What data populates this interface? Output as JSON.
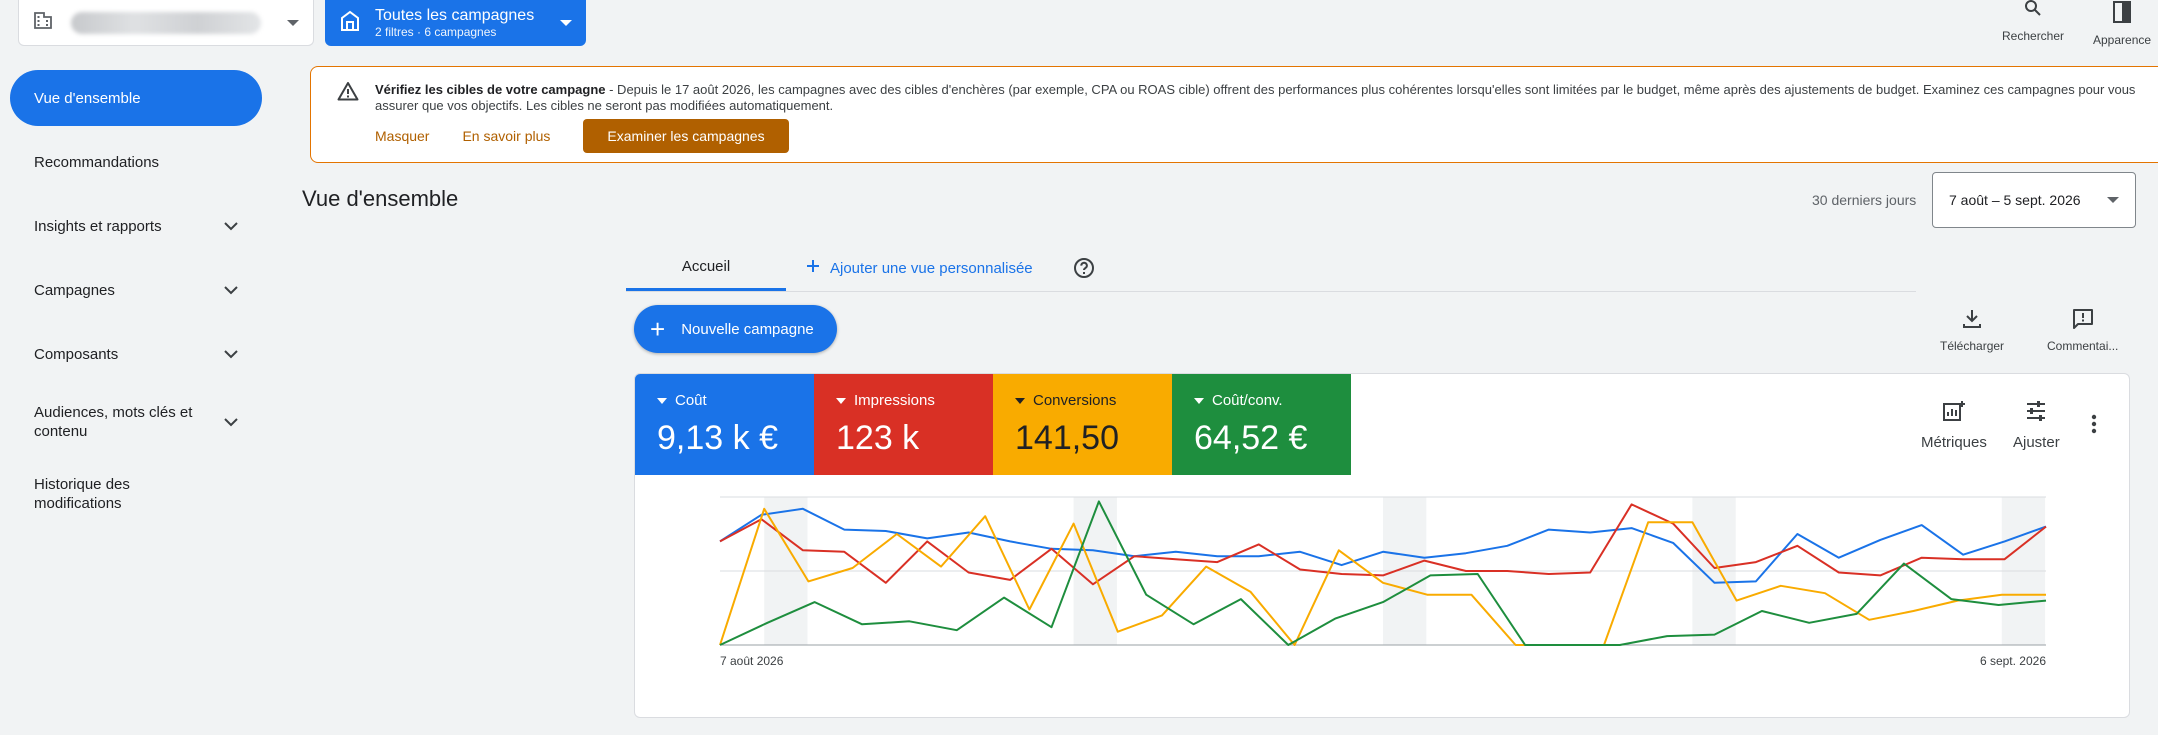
{
  "topbar": {
    "campaign_filter_title": "Toutes les campagnes",
    "campaign_filter_sub": "2 filtres · 6 campagnes",
    "search_label": "Rechercher",
    "appearance_label": "Apparence"
  },
  "sidebar": {
    "items": [
      {
        "label": "Vue d'ensemble"
      },
      {
        "label": "Recommandations"
      },
      {
        "label": "Insights et rapports"
      },
      {
        "label": "Campagnes"
      },
      {
        "label": "Composants"
      },
      {
        "label": "Audiences, mots clés et contenu"
      },
      {
        "label": "Historique des modifications"
      }
    ]
  },
  "banner": {
    "title": "Vérifiez les cibles de votre campagne",
    "text": " - Depuis le 17 août 2026, les campagnes avec des cibles d'enchères (par exemple, CPA ou ROAS cible) offrent des performances plus cohérentes lorsqu'elles sont limitées par le budget, même après des ajustements de budget. Examinez ces campagnes pour vous assurer que vos objectifs. Les cibles ne seront pas modifiées automatiquement.",
    "dismiss": "Masquer",
    "learn_more": "En savoir plus",
    "review": "Examiner les campagnes"
  },
  "header": {
    "title": "Vue d'ensemble",
    "range_label": "30 derniers jours",
    "date_range": "7 août – 5 sept. 2026"
  },
  "tabs": {
    "home": "Accueil",
    "add_view": "Ajouter une vue personnalisée"
  },
  "toolbar": {
    "new_campaign": "Nouvelle campagne",
    "download": "Télécharger",
    "comments": "Commentai..."
  },
  "metrics": [
    {
      "label": "Coût",
      "value": "9,13 k €",
      "color": "#1a73e8"
    },
    {
      "label": "Impressions",
      "value": "123 k",
      "color": "#d93025"
    },
    {
      "label": "Conversions",
      "value": "141,50",
      "color": "#f9ab00"
    },
    {
      "label": "Coût/conv.",
      "value": "64,52 €",
      "color": "#1e8e3e"
    }
  ],
  "card_tools": {
    "metrics": "Métriques",
    "adjust": "Ajuster"
  },
  "chart_data": {
    "type": "line",
    "x_start_label": "7 août 2026",
    "x_end_label": "6 sept. 2026",
    "ylim": [
      0,
      100
    ],
    "grid": true,
    "series": [
      {
        "name": "Coût",
        "color": "#1a73e8",
        "values": [
          70,
          88,
          92,
          78,
          77,
          72,
          76,
          70,
          65,
          64,
          60,
          63,
          60,
          60,
          63,
          54,
          63,
          59,
          62,
          67,
          78,
          76,
          79,
          69,
          42,
          43,
          75,
          59,
          71,
          81,
          61,
          70,
          80
        ]
      },
      {
        "name": "Impressions",
        "color": "#d93025",
        "values": [
          70,
          85,
          64,
          63,
          42,
          70,
          49,
          44,
          65,
          41,
          60,
          58,
          56,
          68,
          51,
          48,
          47,
          57,
          50,
          50,
          48,
          49,
          95,
          82,
          52,
          56,
          67,
          49,
          47,
          59,
          58,
          58,
          80
        ]
      },
      {
        "name": "Conversions",
        "color": "#f9ab00",
        "values": [
          0,
          92,
          43,
          52,
          75,
          53,
          87,
          24,
          82,
          9,
          20,
          53,
          36,
          0,
          64,
          42,
          34,
          34,
          0,
          0,
          0,
          83,
          83,
          30,
          40,
          35,
          17,
          23,
          30,
          34,
          34
        ]
      },
      {
        "name": "Coût/conv.",
        "color": "#1e8e3e",
        "values": [
          0,
          15,
          29,
          14,
          16,
          10,
          32,
          12,
          97,
          34,
          14,
          31,
          0,
          18,
          29,
          47,
          48,
          0,
          0,
          0,
          6,
          7,
          23,
          15,
          21,
          55,
          31,
          27,
          30
        ]
      }
    ]
  }
}
